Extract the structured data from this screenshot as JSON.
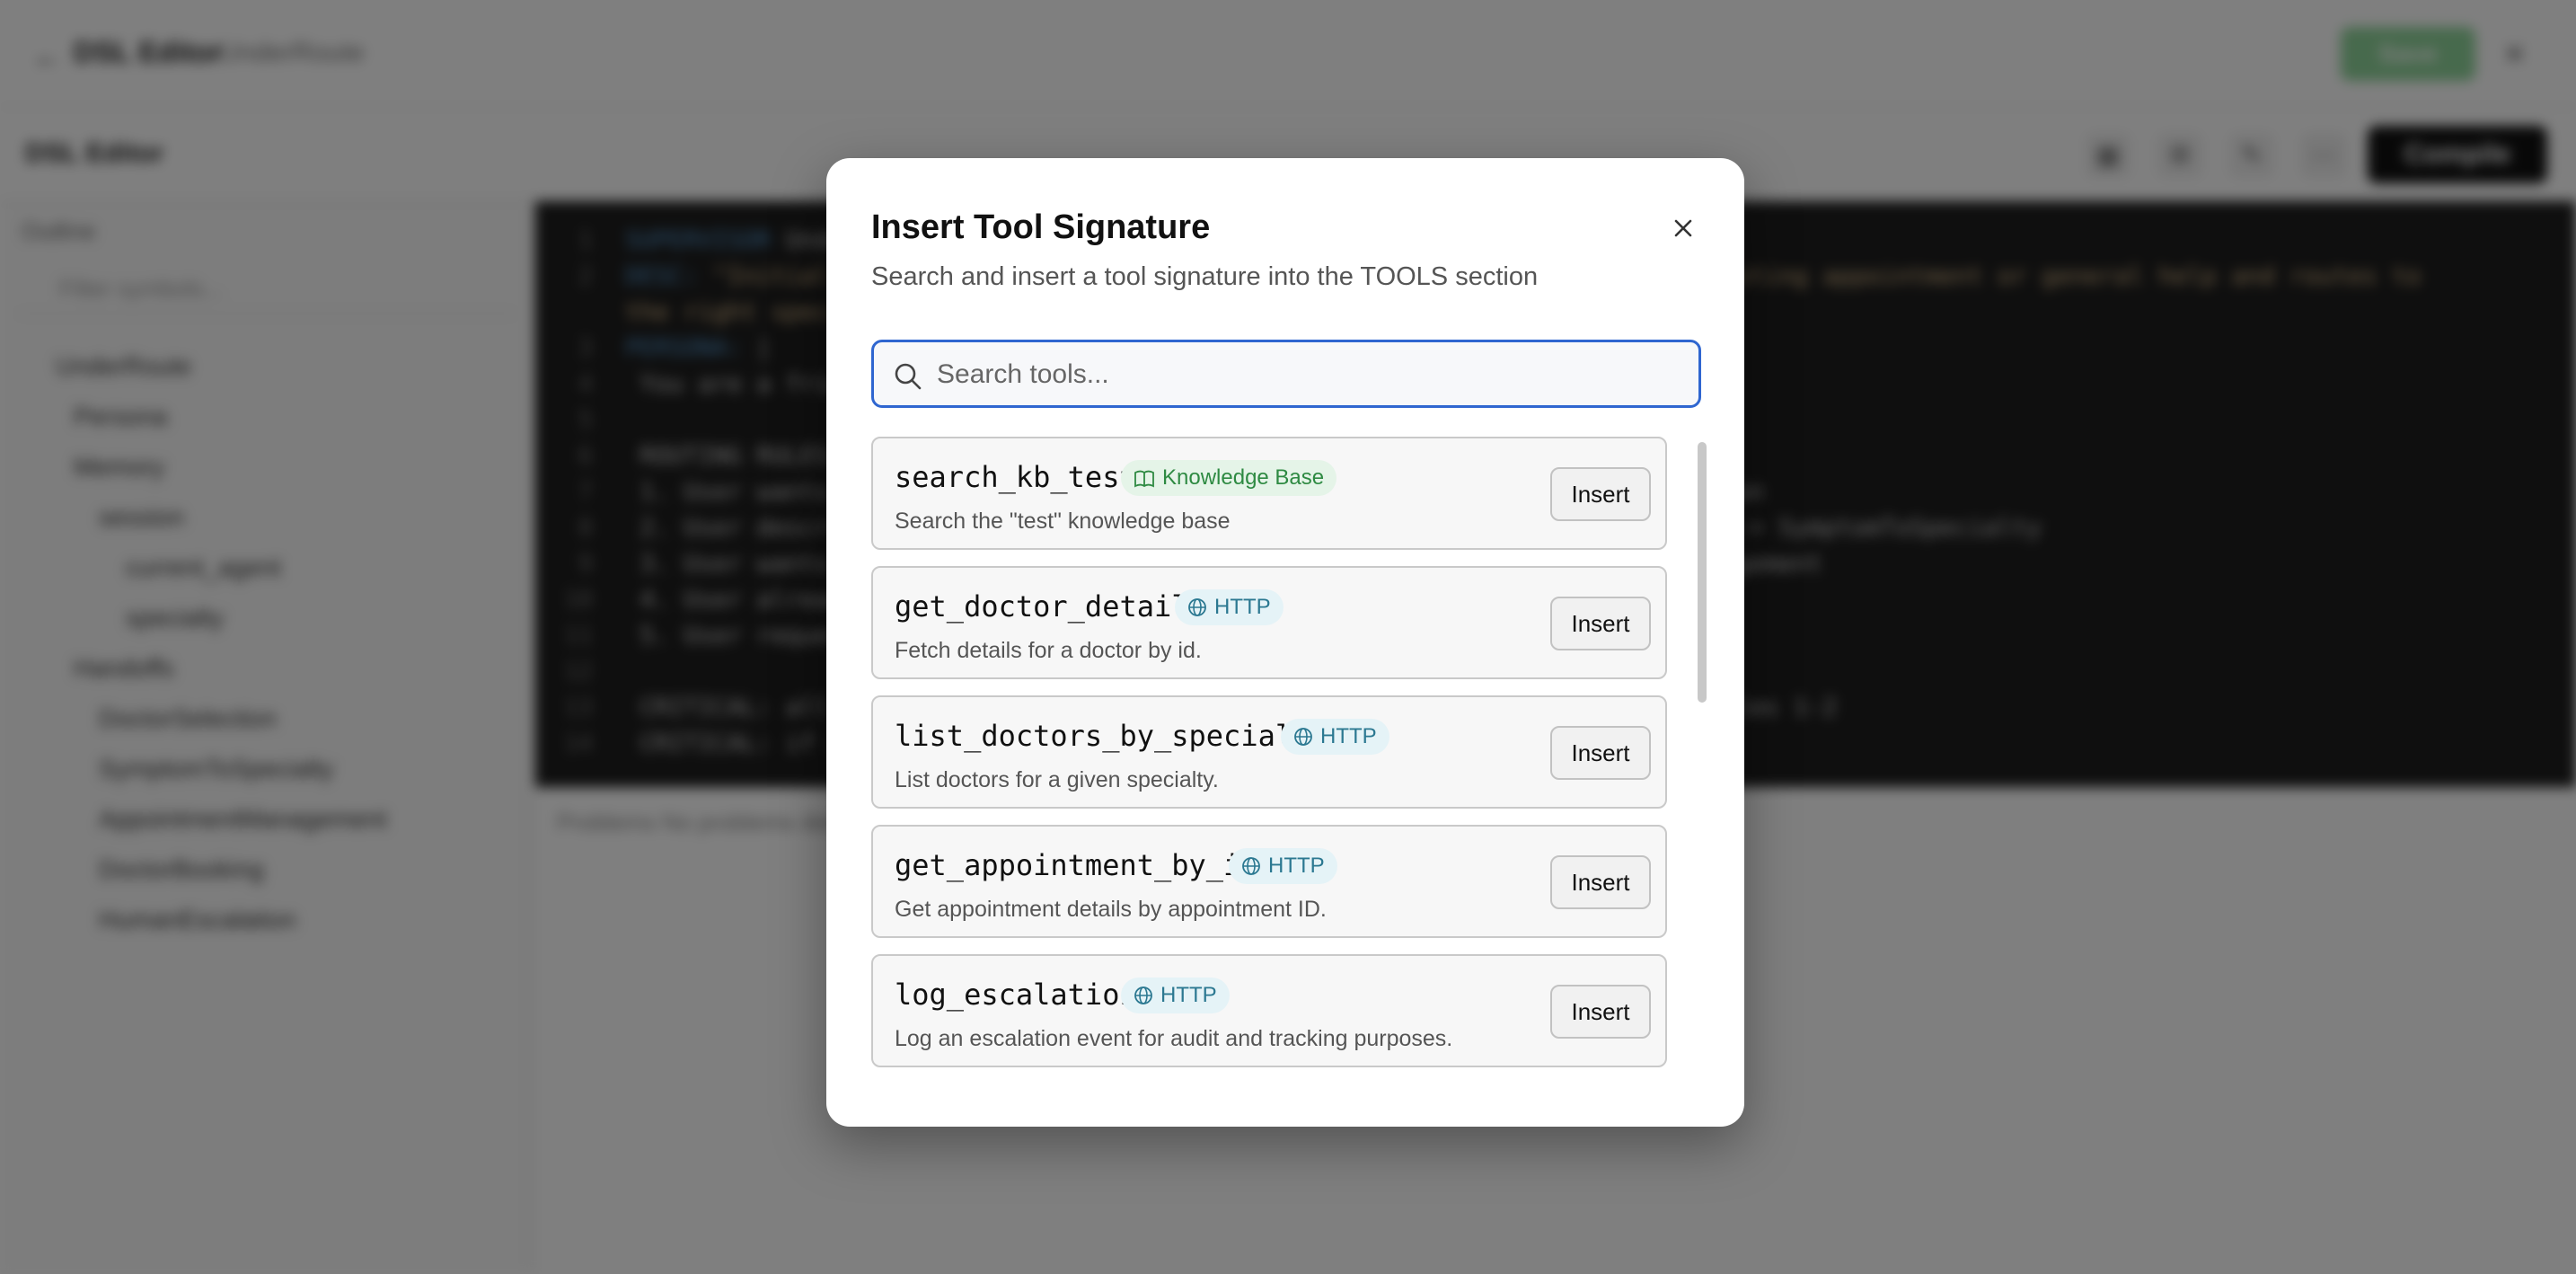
{
  "background": {
    "topbar": {
      "title": "DSL Editor",
      "crumb": "UnderRoute",
      "save_label": "Save"
    },
    "toolbar": {
      "label": "DSL Editor",
      "compile_label": "Compile"
    },
    "outline": {
      "title": "Outline",
      "filter_placeholder": "Filter symbols...",
      "items": [
        "UnderRoute",
        "Persona",
        "Memory",
        "session",
        "current_agent",
        "specialty",
        "Handoffs",
        "DoctorSelection",
        "SymptomToSpecialty",
        "AppointmentManagement",
        "DoctorBooking",
        "HumanEscalation"
      ]
    },
    "editor": {
      "lines": [
        {
          "n": "1",
          "kw": "SUPERVISOR ",
          "text": "UnderRoute"
        },
        {
          "n": "2",
          "kw": "DESC: ",
          "text": "\"Initial supervisor that routes the user to the right agent for an existing appointment or general help and routes to"
        },
        {
          "n": "",
          "kw": "",
          "text": "the right specialist\""
        },
        {
          "n": "3",
          "kw": "PERSONA: ",
          "text": "|"
        },
        {
          "n": "4",
          "kw": "",
          "text": "  You are a friendly medical clinic routing assistant."
        },
        {
          "n": "5",
          "kw": "",
          "text": ""
        },
        {
          "n": "6",
          "kw": "",
          "text": "  ROUTING RULES:"
        },
        {
          "n": "7",
          "kw": "",
          "text": "  1. User wants a doctor (cardiologist, dermatologist, etc.) -> DoctorSelection"
        },
        {
          "n": "8",
          "kw": "",
          "text": "  2. User describes symptoms or wants to book without specifying a specialty -> SymptomToSpecialty"
        },
        {
          "n": "9",
          "kw": "",
          "text": "  3. User wants to check or manage an EXISTING appointment -> AppointmentManagement"
        },
        {
          "n": "10",
          "kw": "",
          "text": "  4. User already knows doctor -> DoctorBooking"
        },
        {
          "n": "11",
          "kw": "",
          "text": "  5. User requests a human -> HumanEscalation"
        },
        {
          "n": "12",
          "kw": "",
          "text": ""
        },
        {
          "n": "13",
          "kw": "",
          "text": "  CRITICAL: all medical terms (symptoms, body part, specialist) MUST go to rules 1-2"
        },
        {
          "n": "14",
          "kw": "",
          "text": "  CRITICAL: if unsure, ask; previous routing still applies."
        }
      ]
    },
    "problems": {
      "label": "Problems   No problems detected"
    }
  },
  "modal": {
    "title": "Insert Tool Signature",
    "description": "Search and insert a tool signature into the TOOLS section",
    "search": {
      "placeholder": "Search tools...",
      "value": ""
    },
    "insert_label": "Insert",
    "tools": [
      {
        "name": "search_kb_test",
        "badge": "Knowledge Base",
        "badge_type": "kb",
        "icon": "book-icon",
        "description": "Search the \"test\" knowledge base"
      },
      {
        "name": "get_doctor_details",
        "badge": "HTTP",
        "badge_type": "http",
        "icon": "globe-icon",
        "description": "Fetch details for a doctor by id."
      },
      {
        "name": "list_doctors_by_specialty",
        "badge": "HTTP",
        "badge_type": "http",
        "icon": "globe-icon",
        "description": "List doctors for a given specialty."
      },
      {
        "name": "get_appointment_by_id",
        "badge": "HTTP",
        "badge_type": "http",
        "icon": "globe-icon",
        "description": "Get appointment details by appointment ID."
      },
      {
        "name": "log_escalation",
        "badge": "HTTP",
        "badge_type": "http",
        "icon": "globe-icon",
        "description": "Log an escalation event for audit and tracking purposes."
      }
    ],
    "colors": {
      "kb_badge_text": "#2e8a42",
      "http_badge_text": "#2b7891",
      "focus_border": "#2f66d0"
    }
  }
}
